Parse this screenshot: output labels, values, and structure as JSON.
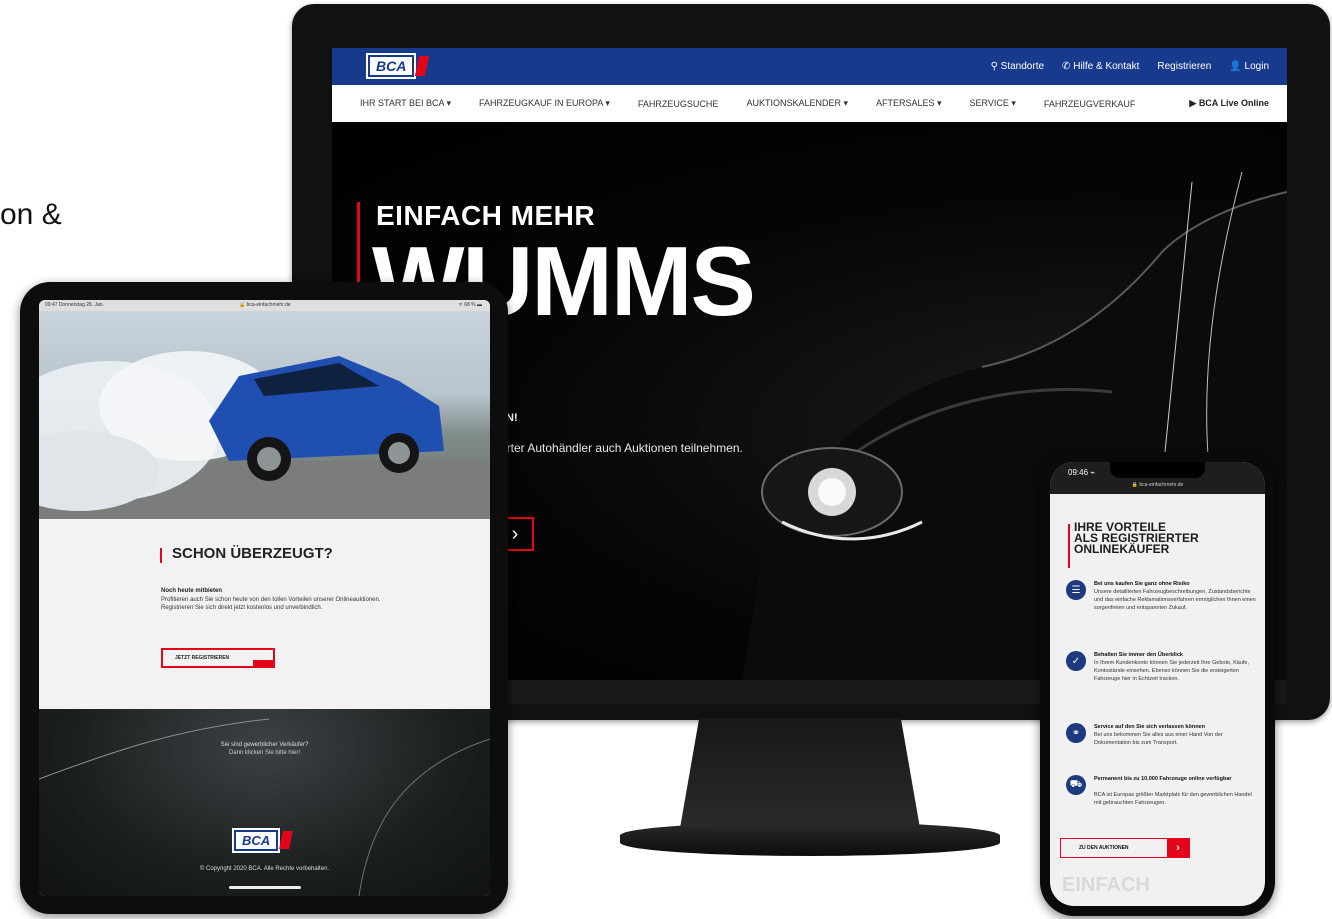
{
  "background": {
    "fragment_text": "on &"
  },
  "colors": {
    "brand_blue": "#173a8c",
    "brand_red": "#e3061b"
  },
  "desktop": {
    "logo": "BCA",
    "top_links": [
      {
        "icon": "map-pin-icon",
        "label": "Standorte"
      },
      {
        "icon": "phone-icon",
        "label": "Hilfe & Kontakt"
      },
      {
        "icon": "",
        "label": "Registrieren"
      },
      {
        "icon": "user-icon",
        "label": "Login"
      }
    ],
    "nav": [
      "IHR START BEI BCA ▾",
      "FAHRZEUGKAUF IN EUROPA ▾",
      "FAHRZEUGSUCHE",
      "AUKTIONSKALENDER ▾",
      "AFTERSALES ▾",
      "SERVICE ▾",
      "FAHRZEUGVERKAUF"
    ],
    "live_label": "▶ BCA Live Online",
    "hero": {
      "title_small": "EINFACH MEHR",
      "title_big": "WUMMS",
      "text_bold": "TEN!",
      "text_body": "strierter Autohändler auch Auktionen teilnehmen. Das",
      "button_arrow": "›"
    }
  },
  "tablet": {
    "status_time": "09:47  Donnerstag 28. Jan.",
    "status_url": "🔒 bca-einfachmehr.de",
    "status_battery": "ᯤ 68 % ▬",
    "heading": "SCHON ÜBERZEUGT?",
    "subheading": "Noch heute mitbieten",
    "paragraph": "Profitieren auch Sie schon heute von den tollen Vorteilen unserer Onlineauktionen. Registrieren Sie sich direkt jetzt kostenlos und unverbindlich.",
    "button": "JETZT REGISTRIEREN",
    "question": "Sie sind gewerblicher Verkäufer?",
    "question_link": "Dann klicken Sie bitte hier!",
    "footer_logo": "BCA",
    "copyright": "© Copyright 2020 BCA. Alle Rechte vorbehalten."
  },
  "phone": {
    "status_time": "09:46 ⌁",
    "url": "🔒 bca-einfachmehr.de",
    "heading": [
      "IHRE VORTEILE",
      "ALS REGISTRIERTER",
      "ONLINEKÄUFER"
    ],
    "items": [
      {
        "icon": "list-icon",
        "glyph": "☰",
        "title": "Bei uns kaufen Sie ganz ohne Risiko",
        "text": "Unsere detaillierten Fahrzeugbeschreibungen, Zustandsberichte und das einfache Reklamationsverfahren ermöglichen Ihnen einen sorgenfreien und entspannten Zukauf."
      },
      {
        "icon": "shield-check-icon",
        "glyph": "✓",
        "title": "Behalten Sie immer den Überblick",
        "text": "In Ihrem Kundenkonto können Sie jederzeit Ihre Gebote, Käufe, Kontostände einsehen. Ebenso können Sie die ersteigerten Fahrzeuge hier in Echtzeit tracken."
      },
      {
        "icon": "handshake-icon",
        "glyph": "⚭",
        "title": "Service auf den Sie sich verlassen können",
        "text": "Bei uns bekommen Sie alles aus einer Hand Von der Dokumentation bis zum Transport."
      },
      {
        "icon": "car-icon",
        "glyph": "⛟",
        "title": "Permanent bis zu 10.000 Fahrzeuge online verfügbar",
        "text": "BCA ist Europas größter Marktplatz für den gewerblichen Handel mit gebrauchten Fahrzeugen."
      }
    ],
    "button": "ZU DEN AUKTIONEN",
    "button_arrow": "›",
    "bottom_text": "EINFACH"
  }
}
